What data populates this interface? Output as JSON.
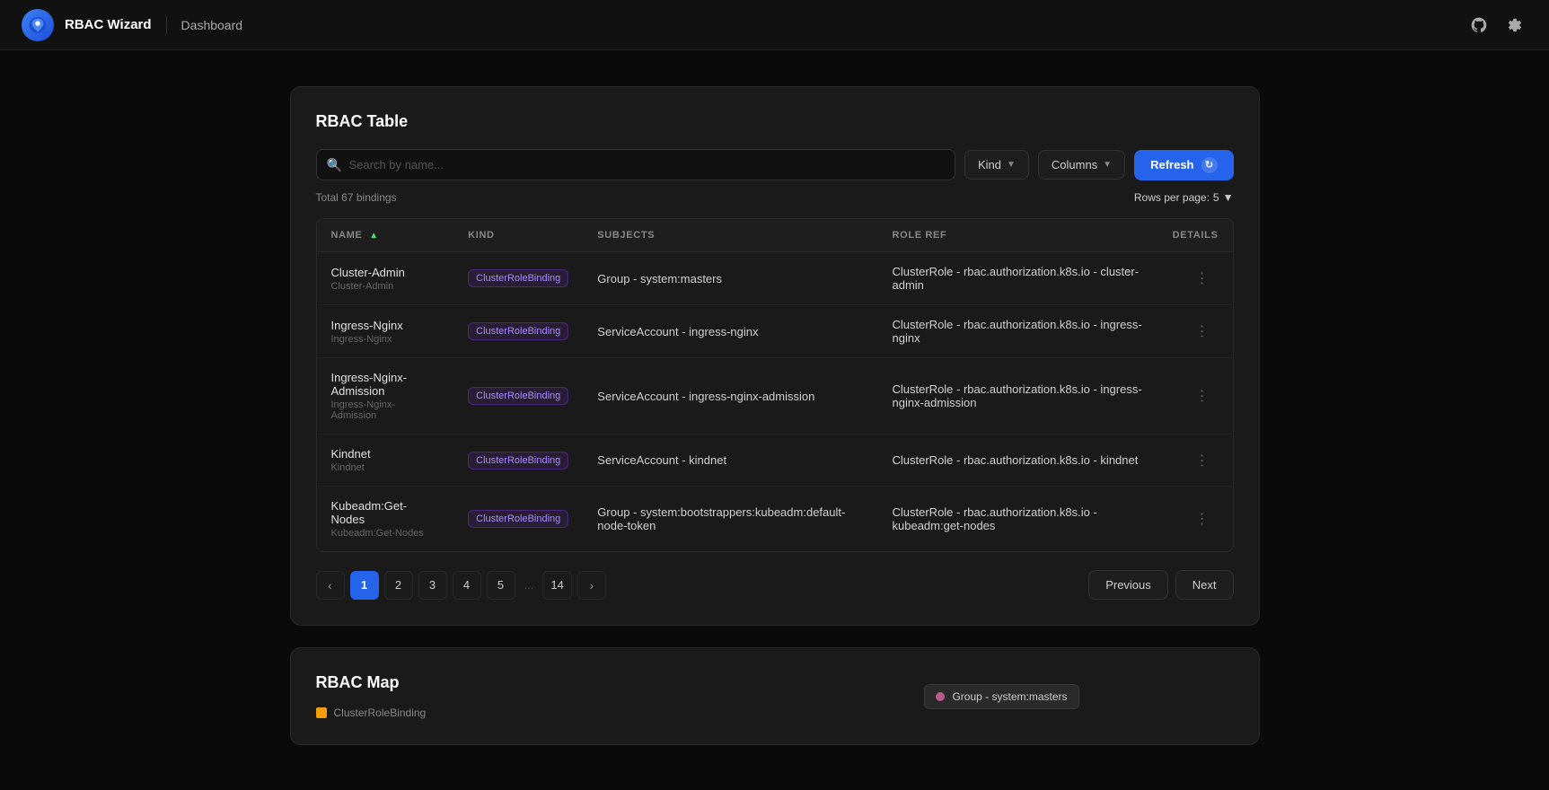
{
  "app": {
    "title": "RBAC Wizard",
    "nav": "Dashboard",
    "logo_char": "🛡"
  },
  "header": {
    "github_icon": "github-icon",
    "settings_icon": "settings-icon"
  },
  "rbac_table": {
    "section_title": "RBAC Table",
    "search_placeholder": "Search by name...",
    "kind_label": "Kind",
    "columns_label": "Columns",
    "refresh_label": "Refresh",
    "total_text": "Total 67 bindings",
    "rows_per_page_label": "Rows per page:",
    "rows_per_page_value": "5",
    "columns": {
      "name": "NAME",
      "kind": "KIND",
      "subjects": "SUBJECTS",
      "role_ref": "ROLE REF",
      "details": "DETAILS"
    },
    "rows": [
      {
        "name_primary": "Cluster-Admin",
        "name_secondary": "Cluster-Admin",
        "kind": "ClusterRoleBinding",
        "subjects": "Group - system:masters",
        "role_ref": "ClusterRole - rbac.authorization.k8s.io - cluster-admin"
      },
      {
        "name_primary": "Ingress-Nginx",
        "name_secondary": "Ingress-Nginx",
        "kind": "ClusterRoleBinding",
        "subjects": "ServiceAccount - ingress-nginx",
        "role_ref": "ClusterRole - rbac.authorization.k8s.io - ingress-nginx"
      },
      {
        "name_primary": "Ingress-Nginx-Admission",
        "name_secondary": "Ingress-Nginx-Admission",
        "kind": "ClusterRoleBinding",
        "subjects": "ServiceAccount - ingress-nginx-admission",
        "role_ref": "ClusterRole - rbac.authorization.k8s.io - ingress-nginx-admission"
      },
      {
        "name_primary": "Kindnet",
        "name_secondary": "Kindnet",
        "kind": "ClusterRoleBinding",
        "subjects": "ServiceAccount - kindnet",
        "role_ref": "ClusterRole - rbac.authorization.k8s.io - kindnet"
      },
      {
        "name_primary": "Kubeadm:Get-Nodes",
        "name_secondary": "Kubeadm:Get-Nodes",
        "kind": "ClusterRoleBinding",
        "subjects": "Group - system:bootstrappers:kubeadm:default-node-token",
        "role_ref": "ClusterRole - rbac.authorization.k8s.io - kubeadm:get-nodes"
      }
    ],
    "pagination": {
      "pages": [
        "1",
        "2",
        "3",
        "4",
        "5",
        "...",
        "14"
      ],
      "prev_label": "Previous",
      "next_label": "Next",
      "current_page": "1"
    }
  },
  "rbac_map": {
    "section_title": "RBAC Map",
    "legend_label": "ClusterRoleBinding",
    "tooltip_text": "Group - system:masters"
  }
}
